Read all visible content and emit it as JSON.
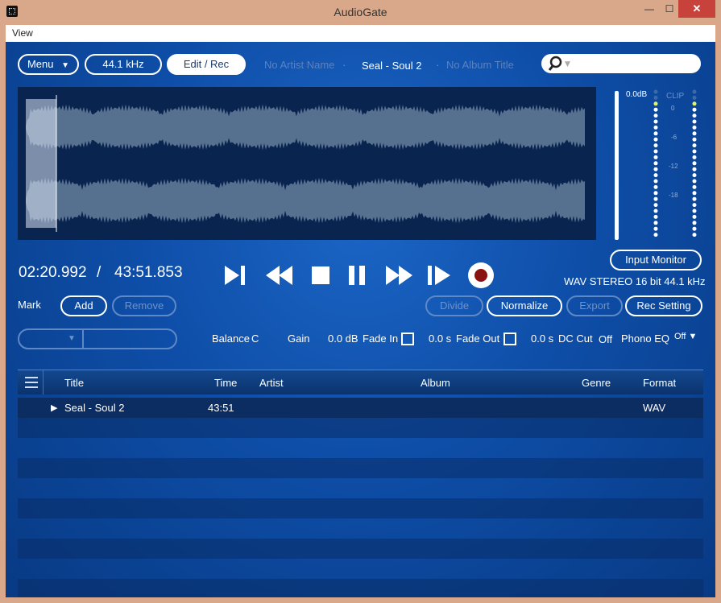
{
  "window": {
    "title": "AudioGate",
    "minimize": "—",
    "maximize": "☐",
    "close": "✕"
  },
  "menubar": {
    "view": "View"
  },
  "toolbar": {
    "menu_label": "Menu",
    "sample_rate": "44.1 kHz",
    "edit_rec": "Edit / Rec",
    "artist": "No Artist Name",
    "sep1": "·",
    "track": "Seal - Soul 2",
    "sep2": "·",
    "album": "No Album Title",
    "search_placeholder": ""
  },
  "meter": {
    "peak_label": "0.0dB",
    "clip_label": "CLIP",
    "scale": [
      "0",
      "-6",
      "-12",
      "-18"
    ]
  },
  "time": {
    "current": "02:20.992",
    "sep": "/",
    "total": "43:51.853"
  },
  "input_monitor": "Input Monitor",
  "format_info": "WAV STEREO 16 bit 44.1 kHz",
  "mark": {
    "label": "Mark",
    "add": "Add",
    "remove": "Remove"
  },
  "edit_buttons": {
    "divide": "Divide",
    "normalize": "Normalize",
    "export": "Export",
    "rec_setting": "Rec Setting"
  },
  "params": {
    "balance_label": "Balance",
    "balance_value": "C",
    "gain_label": "Gain",
    "gain_value": "0.0 dB",
    "fade_in_label": "Fade In",
    "fade_in_value": "0.0 s",
    "fade_out_label": "Fade Out",
    "fade_out_value": "0.0 s",
    "dc_cut_label": "DC Cut",
    "dc_cut_value": "Off",
    "phono_eq_label": "Phono EQ",
    "phono_eq_value": "Off ▼"
  },
  "playlist": {
    "columns": [
      "Title",
      "Time",
      "Artist",
      "Album",
      "Genre",
      "Format"
    ],
    "rows": [
      {
        "title": "Seal - Soul 2",
        "time": "43:51",
        "artist": "",
        "album": "",
        "genre": "",
        "format": "WAV"
      }
    ]
  },
  "colors": {
    "accent": "#0e4ea8",
    "record": "#8b1010",
    "panel": "#0a2450"
  },
  "playback_progress": 0.054
}
